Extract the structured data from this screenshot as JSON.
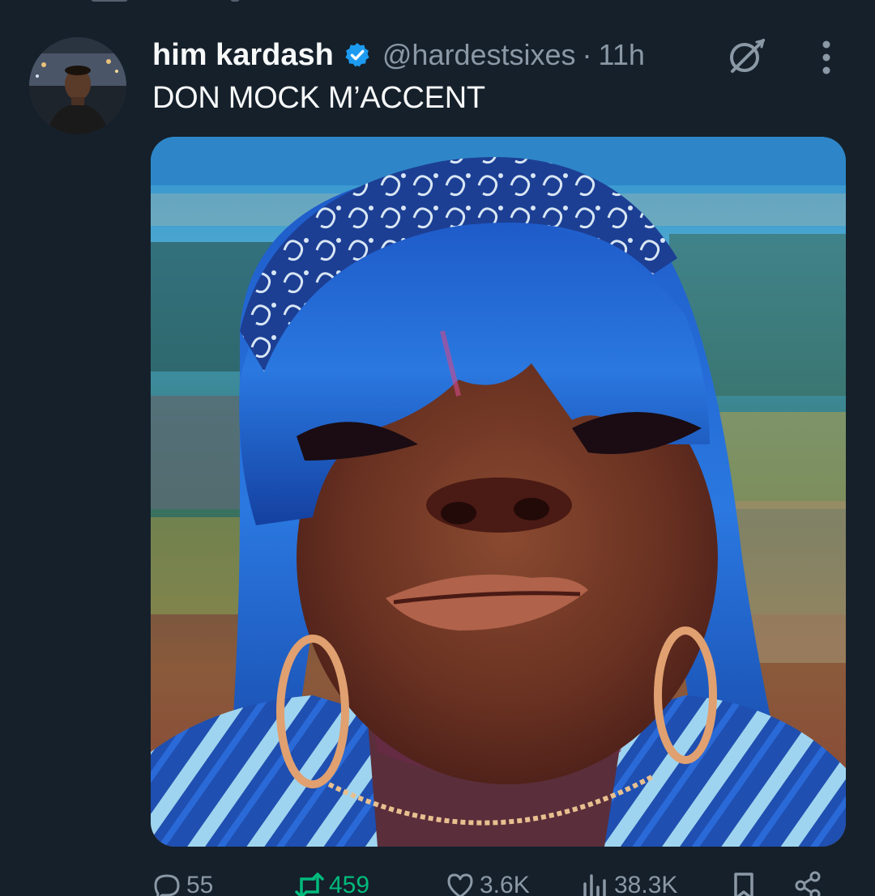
{
  "post": {
    "display_name": "him kardash",
    "handle": "@hardestsixes",
    "separator": "·",
    "timestamp": "11h",
    "text": "DON MOCK M’ACCENT"
  },
  "actions": {
    "replies": "55",
    "reposts": "459",
    "likes": "3.6K",
    "views": "38.3K"
  },
  "colors": {
    "background": "#15202b",
    "text": "#f7f9f9",
    "secondary_text": "#8b98a5",
    "verified": "#1d9bf0",
    "repost_active": "#00ba7c"
  },
  "icons": {
    "verified": "verified-badge-icon",
    "grok": "grok-icon",
    "more": "more-options-icon",
    "reply": "reply-icon",
    "repost": "repost-icon",
    "like": "like-icon",
    "views": "views-icon",
    "bookmark": "bookmark-icon",
    "share": "share-icon"
  }
}
